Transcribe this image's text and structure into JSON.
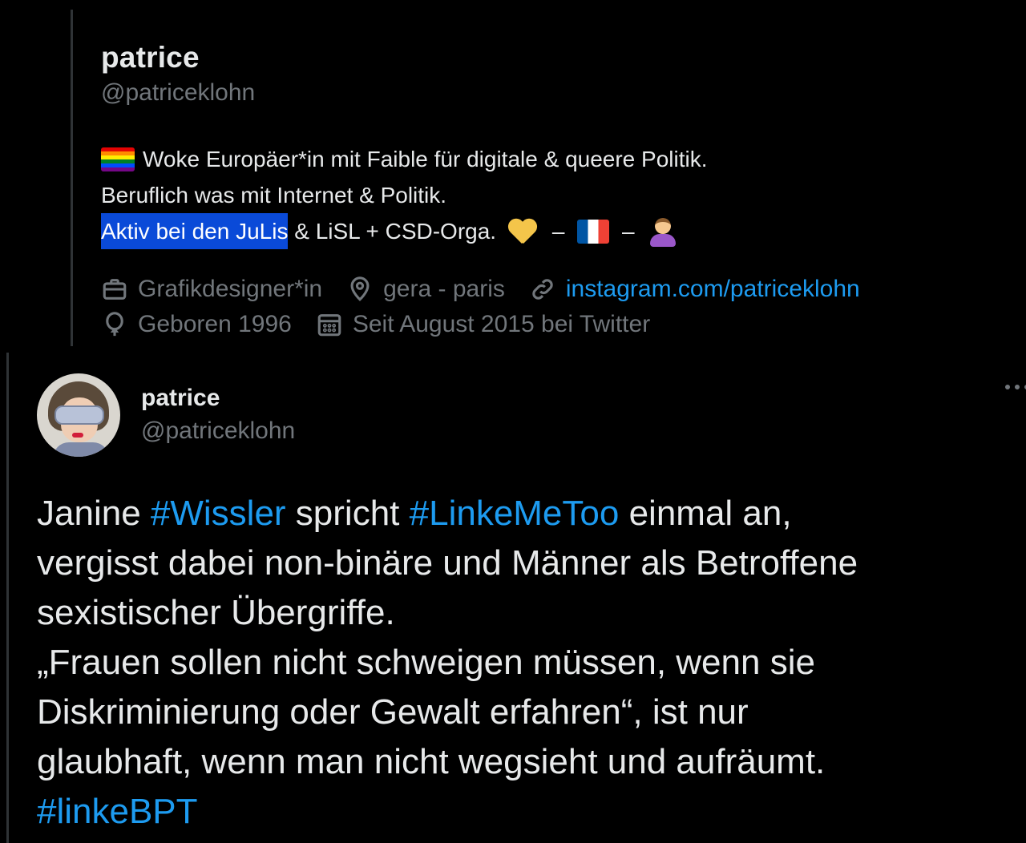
{
  "profile": {
    "name": "patrice",
    "handle": "@patriceklohn",
    "bio": {
      "line1": "Woke Europäer*in mit Faible für digitale & queere Politik.",
      "line2": "Beruflich was mit Internet & Politik.",
      "line3_highlight": "Aktiv bei den JuLis",
      "line3_rest": " & LiSL + CSD-Orga.",
      "sep1": " – ",
      "sep2": " – ",
      "icons": [
        "rainbow-flag-icon",
        "yellow-heart-icon",
        "france-flag-icon",
        "person-icon"
      ]
    },
    "meta": {
      "profession": "Grafikdesigner*in",
      "location": "gera - paris",
      "website": "instagram.com/patriceklohn",
      "born": "Geboren 1996",
      "joined": "Seit August 2015 bei Twitter"
    }
  },
  "tweet": {
    "name": "patrice",
    "handle": "@patriceklohn",
    "text": {
      "l1_a": "Janine ",
      "l1_tag1": "#Wissler",
      "l1_b": " spricht ",
      "l1_tag2": "#LinkeMeToo",
      "l1_c": " einmal an,",
      "l2": "vergisst dabei non-binäre und Männer als Betroffene",
      "l3": "sexistischer Übergriffe.",
      "l4": "„Frauen sollen nicht schweigen müssen, wenn sie",
      "l5": "Diskriminierung oder Gewalt erfahren“, ist nur",
      "l6": "glaubhaft, wenn man nicht wegsieht und aufräumt.",
      "l7_tag": "#linkeBPT"
    }
  },
  "colors": {
    "background": "#000000",
    "text": "#e7e9ea",
    "secondary": "#71767b",
    "link": "#1d9bf0",
    "highlight": "#0a4ad8"
  }
}
